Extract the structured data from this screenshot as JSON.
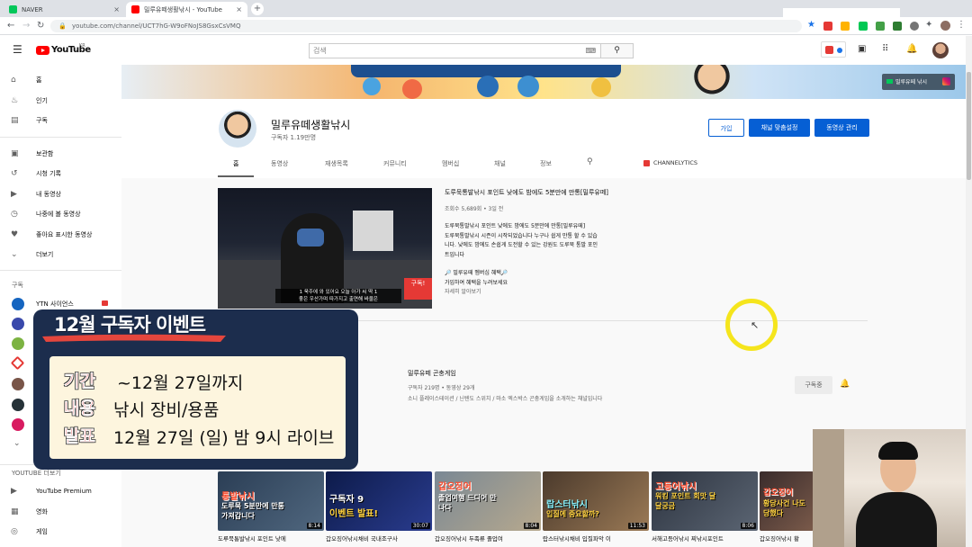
{
  "browser": {
    "tabs": [
      {
        "title": "NAVER",
        "close": "×"
      },
      {
        "title": "밀루유떼생활낚시 - YouTube",
        "close": "×"
      }
    ],
    "new_tab": "+",
    "url": "youtube.com/channel/UCT7hG-W9oFNoJS8GsxCsVMQ"
  },
  "header": {
    "logo": "YouTube",
    "region": "KR",
    "search_placeholder": "검색"
  },
  "sidebar": {
    "items": [
      {
        "label": "홈",
        "icon": "home-icon",
        "glyph": "⌂"
      },
      {
        "label": "인기",
        "icon": "flame-icon",
        "glyph": "♨"
      },
      {
        "label": "구독",
        "icon": "subscriptions-icon",
        "glyph": "▤"
      },
      {
        "label": "보관함",
        "icon": "library-icon",
        "glyph": "▣"
      },
      {
        "label": "시청 기록",
        "icon": "history-icon",
        "glyph": "↺"
      },
      {
        "label": "내 동영상",
        "icon": "my-videos-icon",
        "glyph": "▶"
      },
      {
        "label": "나중에 볼 동영상",
        "icon": "watch-later-icon",
        "glyph": "◷"
      },
      {
        "label": "좋아요 표시한 동영상",
        "icon": "like-icon",
        "glyph": "♥"
      },
      {
        "label": "더보기",
        "icon": "chevron-down-icon",
        "glyph": "⌄"
      }
    ],
    "subs_heading": "구독",
    "first_sub": "YTN 사이언스",
    "more_section": "YOUTUBE 더보기",
    "more_items": [
      {
        "label": "YouTube Premium",
        "glyph": "▶"
      },
      {
        "label": "영화",
        "glyph": "▦"
      },
      {
        "label": "게임",
        "glyph": "◎"
      }
    ]
  },
  "banner": {
    "badge": "밀루유떼 낚시"
  },
  "channel": {
    "name": "밀루유떼생활낚시",
    "subscribers": "구독자 1.19만명",
    "buttons": {
      "analytics": "가입",
      "customize": "채널 맞춤설정",
      "manage": "동영상 관리"
    },
    "tabs": [
      "홈",
      "동영상",
      "재생목록",
      "커뮤니티",
      "멤버십",
      "채널",
      "정보"
    ],
    "channelytics": "CHANNELYTICS"
  },
  "featured": {
    "title": "도루묵통발낚시 포인트 낮에도 밤에도 5분만에 만통[밀루유떼]",
    "meta": "조회수 5,689회 • 3일 전",
    "desc_lines": [
      "도루묵통발낚시 포인트 낮에도 밤에도 5분만에 만통[밀루유떼]",
      "도루묵통발낚시 시즌이 시작되었습니다 누구나 쉽게 만통 할 수 있습",
      "니다. 낮에도 밤에도 손쉽게 도전할 수 있는 강원도 도루묵 통발 포인",
      "트입니다",
      "",
      "🔎 밀루유떼 멤버십 혜택🔎",
      "가입하여 혜택을 누려보세요",
      "자세히 알아보기"
    ],
    "subtitle_1": "1 욱주에 와 있어요 오늘 아가 씨 딱 1",
    "subtitle_2": "좋은 우산가며 따가지고 출연해 바울은",
    "sticker": "구독!"
  },
  "game_channel": {
    "name": "밀루유떼 곤충게임",
    "meta": "구독자 219명 • 동영상 29개",
    "desc": "소니 플레이스테이션 / 닌텐도 스위치 / 마소 엑스박스 곤충게임을 소개하는 채널입니다",
    "button": "구독중"
  },
  "promo": {
    "title": "12월 구독자 이벤트",
    "rows": [
      {
        "label": "기간",
        "value": "~12월 27일까지"
      },
      {
        "label": "내용",
        "value": "낚시 장비/용품"
      },
      {
        "label": "발표",
        "value": "12월 27일 (일) 밤 9시 라이브"
      }
    ]
  },
  "videos": [
    {
      "cap1": "통발낚시",
      "cap2": "도루묵 5분만에 만통 가져갑니다",
      "duration": "8:14",
      "title": "도루묵통발낚시 포인트 낮에"
    },
    {
      "cap1": "구독자 9",
      "cap2": "이벤트 발표!",
      "duration": "30:07",
      "title": "갑오징어낚시채비 국내조구사"
    },
    {
      "cap1": "갑오징어",
      "cap2": "졸업여행 드디어 만나다",
      "duration": "8:04",
      "title": "갑오징어낚시 두족류 졸업여"
    },
    {
      "cap1": "랍스터낚시",
      "cap2": "입질에 중요할까?",
      "duration": "11:53",
      "title": "랍스터낚시채비 입질파악 이"
    },
    {
      "cap1": "고등어낚시",
      "cap2": "워킹 포인트 회맛 달달궁금",
      "duration": "8:06",
      "title": "서해고등어낚시 찌낚시포인트"
    },
    {
      "cap1": "갑오징어",
      "cap2": "황당사건 나도 당했다",
      "duration": "",
      "title": "갑오징어낚시 황"
    }
  ],
  "colors": {
    "youtube_red": "#ff0000",
    "button_blue": "#065fd4",
    "promo_navy": "#1c2d4d",
    "promo_red": "#e52626",
    "cursor_ring": "#f5e51d"
  }
}
